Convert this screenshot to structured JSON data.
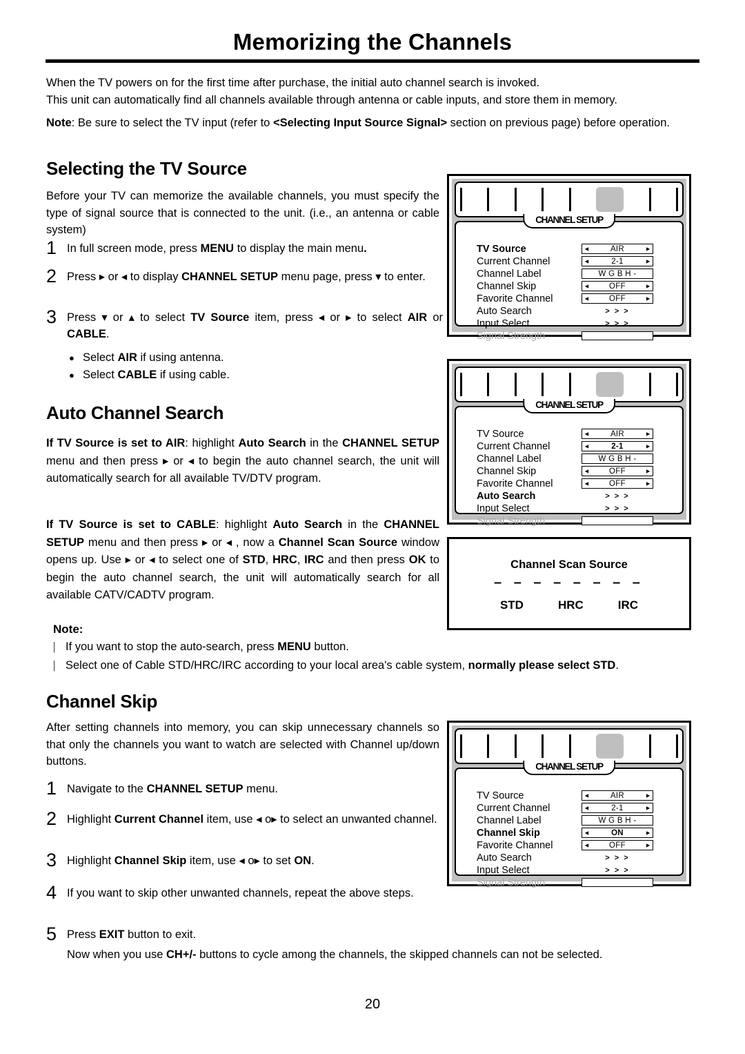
{
  "document": {
    "title": "Memorizing the Channels",
    "page_number": "20",
    "intro": {
      "line1": "When the TV powers on for the first time after purchase, the initial auto channel search is invoked.",
      "line2": "This unit can automatically find all channels available through antenna or cable inputs, and store them in memory.",
      "note_label": "Note",
      "note_text_a": ": Be sure to select the TV input (refer to ",
      "note_bold": "<Selecting Input Source Signal>",
      "note_text_b": " section on previous page) before operation."
    }
  },
  "sections": {
    "tv_source": {
      "heading": "Selecting the TV Source",
      "paragraph": "Before your TV can memorize the available channels, you must specify the type of signal source that is connected to the unit. (i.e., an antenna or cable system)",
      "steps": [
        {
          "num": "1",
          "parts": [
            {
              "t": "In full screen mode, press ",
              "b": false
            },
            {
              "t": "MENU",
              "b": true
            },
            {
              "t": " to display the main menu",
              "b": false
            },
            {
              "t": ".",
              "b": true
            }
          ]
        },
        {
          "num": "2",
          "parts": [
            {
              "t": "Press ",
              "b": false
            },
            {
              "t": "▸",
              "b": false
            },
            {
              "t": " or ",
              "b": false
            },
            {
              "t": "◂",
              "b": false
            },
            {
              "t": " to display ",
              "b": false
            },
            {
              "t": "CHANNEL SETUP",
              "b": true
            },
            {
              "t": " menu page, press ",
              "b": false
            },
            {
              "t": "▾",
              "b": false
            },
            {
              "t": " to enter.",
              "b": false
            }
          ]
        },
        {
          "num": "3",
          "parts": [
            {
              "t": "Press ",
              "b": false
            },
            {
              "t": "▾",
              "b": false
            },
            {
              "t": " or ",
              "b": false
            },
            {
              "t": "▴",
              "b": false
            },
            {
              "t": " to select ",
              "b": false
            },
            {
              "t": "TV Source",
              "b": true
            },
            {
              "t": " item, press ",
              "b": false
            },
            {
              "t": "◂",
              "b": false
            },
            {
              "t": " or ",
              "b": false
            },
            {
              "t": "▸",
              "b": false
            },
            {
              "t": " to select ",
              "b": false
            },
            {
              "t": "AIR",
              "b": true
            },
            {
              "t": " or ",
              "b": false
            },
            {
              "t": "CABLE",
              "b": true
            },
            {
              "t": ".",
              "b": false
            }
          ]
        }
      ],
      "bullets": [
        {
          "marker": "●",
          "parts": [
            {
              "t": "Select ",
              "b": false
            },
            {
              "t": "AIR",
              "b": true
            },
            {
              "t": " if using antenna.",
              "b": false
            }
          ]
        },
        {
          "marker": "●",
          "parts": [
            {
              "t": "Select ",
              "b": false
            },
            {
              "t": "CABLE",
              "b": true
            },
            {
              "t": " if using cable.",
              "b": false
            }
          ]
        }
      ]
    },
    "auto_channel_search": {
      "heading": "Auto Channel Search",
      "paragraph_air": [
        {
          "t": "If TV Source is set to AIR",
          "b": true
        },
        {
          "t": ": highlight ",
          "b": false
        },
        {
          "t": "Auto Search",
          "b": true
        },
        {
          "t": " in the ",
          "b": false
        },
        {
          "t": "CHANNEL SETUP",
          "b": true
        },
        {
          "t": " menu and then press ",
          "b": false
        },
        {
          "t": "▸",
          "b": false
        },
        {
          "t": " or ",
          "b": false
        },
        {
          "t": "◂",
          "b": false
        },
        {
          "t": " to begin the auto channel search, the unit will automatically search for all available TV/DTV program.",
          "b": false
        }
      ],
      "paragraph_cable": [
        {
          "t": "If TV Source is set to CABLE",
          "b": true
        },
        {
          "t": ": highlight ",
          "b": false
        },
        {
          "t": "Auto Search",
          "b": true
        },
        {
          "t": " in the ",
          "b": false
        },
        {
          "t": "CHANNEL SETUP",
          "b": true
        },
        {
          "t": " menu and then press ",
          "b": false
        },
        {
          "t": "▸",
          "b": false
        },
        {
          "t": " or ",
          "b": false
        },
        {
          "t": "◂",
          "b": false
        },
        {
          "t": " , now a ",
          "b": false
        },
        {
          "t": "Channel Scan Source",
          "b": true
        },
        {
          "t": " window opens up. Use ",
          "b": false
        },
        {
          "t": "▸",
          "b": false
        },
        {
          "t": " or ",
          "b": false
        },
        {
          "t": "◂",
          "b": false
        },
        {
          "t": " to select one of ",
          "b": false
        },
        {
          "t": "STD",
          "b": true
        },
        {
          "t": ", ",
          "b": false
        },
        {
          "t": "HRC",
          "b": true
        },
        {
          "t": ", ",
          "b": false
        },
        {
          "t": "IRC",
          "b": true
        },
        {
          "t": " and then press ",
          "b": false
        },
        {
          "t": "OK",
          "b": true
        },
        {
          "t": " to begin the auto channel search, the unit will automatically search for all available CATV/CADTV program.",
          "b": false
        }
      ],
      "note": {
        "label": "Note:",
        "items": [
          {
            "marker": "|",
            "parts": [
              {
                "t": "If you want to stop the auto-search, press ",
                "b": false
              },
              {
                "t": "MENU",
                "b": true
              },
              {
                "t": " button.",
                "b": false
              }
            ]
          },
          {
            "marker": "|",
            "parts": [
              {
                "t": "Select one of Cable STD/HRC/IRC according to your local area's cable system, ",
                "b": false
              },
              {
                "t": "normally please select STD",
                "b": true
              },
              {
                "t": ".",
                "b": false
              }
            ]
          }
        ]
      }
    },
    "channel_skip": {
      "heading": "Channel Skip",
      "paragraph": "After setting channels into memory, you can skip unnecessary channels so that only the channels you want to watch are selected with Channel up/down buttons.",
      "steps": [
        {
          "num": "1",
          "parts": [
            {
              "t": "Navigate to the ",
              "b": false
            },
            {
              "t": "CHANNEL SETUP",
              "b": true
            },
            {
              "t": " menu.",
              "b": false
            }
          ]
        },
        {
          "num": "2",
          "parts": [
            {
              "t": "Highlight ",
              "b": false
            },
            {
              "t": "Current Channel",
              "b": true
            },
            {
              "t": " item, use ",
              "b": false
            },
            {
              "t": "◂",
              "b": false
            },
            {
              "t": " o",
              "b": false
            },
            {
              "t": "▸",
              "b": false
            },
            {
              "t": " to select an unwanted channel.",
              "b": false
            }
          ]
        },
        {
          "num": "3",
          "parts": [
            {
              "t": "Highlight ",
              "b": false
            },
            {
              "t": "Channel Skip",
              "b": true
            },
            {
              "t": " item, use ",
              "b": false
            },
            {
              "t": "◂",
              "b": false
            },
            {
              "t": " o",
              "b": false
            },
            {
              "t": "▸",
              "b": false
            },
            {
              "t": " to set ",
              "b": false
            },
            {
              "t": "ON",
              "b": true
            },
            {
              "t": ".",
              "b": false
            }
          ]
        },
        {
          "num": "4",
          "parts": [
            {
              "t": "If you want to skip other unwanted channels, repeat the above steps.",
              "b": false
            }
          ]
        },
        {
          "num": "5",
          "parts": [
            {
              "t": "Press ",
              "b": false
            },
            {
              "t": "EXIT",
              "b": true
            },
            {
              "t": " button to exit.",
              "b": false
            }
          ]
        }
      ],
      "final_note": [
        {
          "t": "Now when you use ",
          "b": false
        },
        {
          "t": "CH+/-",
          "b": true
        },
        {
          "t": " buttons to cycle among the channels, the skipped channels can not be selected.",
          "b": false
        }
      ]
    }
  },
  "osd_menus": [
    {
      "id": "osd-tv-source",
      "tab_label": "CHANNEL SETUP",
      "highlight_index": 4,
      "rows": [
        {
          "label": "TV Source",
          "type": "spinner",
          "value": "AIR",
          "highlighted": true,
          "dim": false
        },
        {
          "label": "Current Channel",
          "type": "spinner",
          "value": "2-1",
          "highlighted": false,
          "dim": false
        },
        {
          "label": "Channel Label",
          "type": "plain",
          "value": "W G B H -",
          "highlighted": false,
          "dim": false
        },
        {
          "label": "Channel Skip",
          "type": "spinner",
          "value": "OFF",
          "highlighted": false,
          "dim": false
        },
        {
          "label": "Favorite Channel",
          "type": "spinner",
          "value": "OFF",
          "highlighted": false,
          "dim": false
        },
        {
          "label": "Auto Search",
          "type": "arrows",
          "value": "> > >",
          "highlighted": false,
          "dim": false
        },
        {
          "label": "Input Select",
          "type": "arrows",
          "value": "> > >",
          "highlighted": false,
          "dim": false
        },
        {
          "label": "Signal Strength",
          "type": "meter",
          "value": "",
          "highlighted": false,
          "dim": true
        }
      ]
    },
    {
      "id": "osd-auto-search",
      "tab_label": "CHANNEL SETUP",
      "highlight_index": 4,
      "rows": [
        {
          "label": "TV Source",
          "type": "spinner",
          "value": "AIR",
          "highlighted": false,
          "dim": false
        },
        {
          "label": "Current Channel",
          "type": "spinner",
          "value": "2-1",
          "highlighted": false,
          "dim": false,
          "value_bold": true
        },
        {
          "label": "Channel Label",
          "type": "plain",
          "value": "W G B H -",
          "highlighted": false,
          "dim": false
        },
        {
          "label": "Channel Skip",
          "type": "spinner",
          "value": "OFF",
          "highlighted": false,
          "dim": false
        },
        {
          "label": "Favorite Channel",
          "type": "spinner",
          "value": "OFF",
          "highlighted": false,
          "dim": false
        },
        {
          "label": "Auto Search",
          "type": "arrows",
          "value": "> > >",
          "highlighted": true,
          "dim": false
        },
        {
          "label": "Input Select",
          "type": "arrows",
          "value": "> > >",
          "highlighted": false,
          "dim": false
        },
        {
          "label": "Signal Strength",
          "type": "meter",
          "value": "",
          "highlighted": false,
          "dim": true
        }
      ]
    },
    {
      "id": "osd-channel-skip",
      "tab_label": "CHANNEL SETUP",
      "highlight_index": 4,
      "rows": [
        {
          "label": "TV Source",
          "type": "spinner",
          "value": "AIR",
          "highlighted": false,
          "dim": false
        },
        {
          "label": "Current Channel",
          "type": "spinner",
          "value": "2-1",
          "highlighted": false,
          "dim": false
        },
        {
          "label": "Channel Label",
          "type": "plain",
          "value": "W G B H -",
          "highlighted": false,
          "dim": false
        },
        {
          "label": "Channel Skip",
          "type": "spinner",
          "value": "ON",
          "highlighted": true,
          "dim": false,
          "value_bold": true
        },
        {
          "label": "Favorite Channel",
          "type": "spinner",
          "value": "OFF",
          "highlighted": false,
          "dim": false
        },
        {
          "label": "Auto Search",
          "type": "arrows",
          "value": "> > >",
          "highlighted": false,
          "dim": false
        },
        {
          "label": "Input Select",
          "type": "arrows",
          "value": "> > >",
          "highlighted": false,
          "dim": false
        },
        {
          "label": "Signal Strength",
          "type": "meter",
          "value": "",
          "highlighted": false,
          "dim": true
        }
      ]
    }
  ],
  "scan_source_window": {
    "title": "Channel Scan Source",
    "dashes": "– – – – – – – –",
    "options": [
      "STD",
      "HRC",
      "IRC"
    ]
  },
  "colors": {
    "osd_frame": "#bfbfbf",
    "osd_highlight": "#bfbfbf",
    "dim_text": "#a9a9a9",
    "ink": "#000000",
    "paper": "#ffffff"
  }
}
